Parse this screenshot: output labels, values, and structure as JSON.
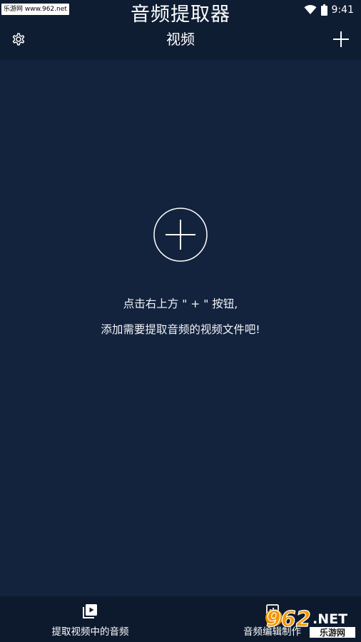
{
  "status_bar": {
    "watermark": "乐游网 www.962.net",
    "time": "9:41"
  },
  "header": {
    "app_title": "音频提取器",
    "page_title": "视频",
    "settings_icon": "gear-icon",
    "add_icon": "plus-icon"
  },
  "empty_state": {
    "add_icon": "circle-plus-icon",
    "hint_line1": "点击右上方 \" + \" 按钮,",
    "hint_line2": "添加需要提取音频的视频文件吧!"
  },
  "bottom_nav": {
    "tabs": [
      {
        "label": "提取视频中的音频",
        "icon": "video-library-icon",
        "selected": true
      },
      {
        "label": "音频编辑制作",
        "icon": "audio-edit-icon",
        "selected": false
      }
    ]
  },
  "watermark_logo": {
    "number": "962",
    "suffix": ".NET",
    "text": "乐游网"
  },
  "colors": {
    "background": "#13233d",
    "header": "#0f1d33",
    "bottom_bar": "#0d1a2e",
    "text": "#ffffff",
    "watermark_orange": "#f39800"
  }
}
